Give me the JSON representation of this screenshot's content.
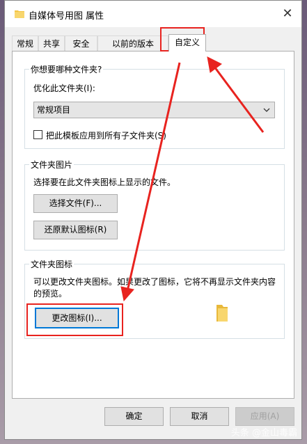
{
  "window": {
    "title": "自媒体号用图 属性",
    "close_glyph": "✕"
  },
  "tabs": [
    "常规",
    "共享",
    "安全",
    "以前的版本",
    "自定义"
  ],
  "optimize_group": {
    "title": "你想要哪种文件夹?",
    "optimize_label": "优化此文件夹(I):",
    "selected_option": "常规项目",
    "apply_template_label": "把此模板应用到所有子文件夹(S)",
    "apply_template_checked": false
  },
  "picture_group": {
    "title": "文件夹图片",
    "description": "选择要在此文件夹图标上显示的文件。",
    "choose_file_label": "选择文件(F)...",
    "restore_default_label": "还原默认图标(R)"
  },
  "icon_group": {
    "title": "文件夹图标",
    "description_line1": "可以更改文件夹图标。如果更改了图标，它将不再显示文件夹内容",
    "description_line2": "的预览。",
    "change_icon_label": "更改图标(I)..."
  },
  "footer": {
    "ok_label": "确定",
    "cancel_label": "取消",
    "apply_label": "应用(A)"
  },
  "watermark": "头条 @金山毒霸",
  "colors": {
    "highlight": "#e8231f",
    "folder": "#f4c542",
    "focus": "#0078d7"
  }
}
